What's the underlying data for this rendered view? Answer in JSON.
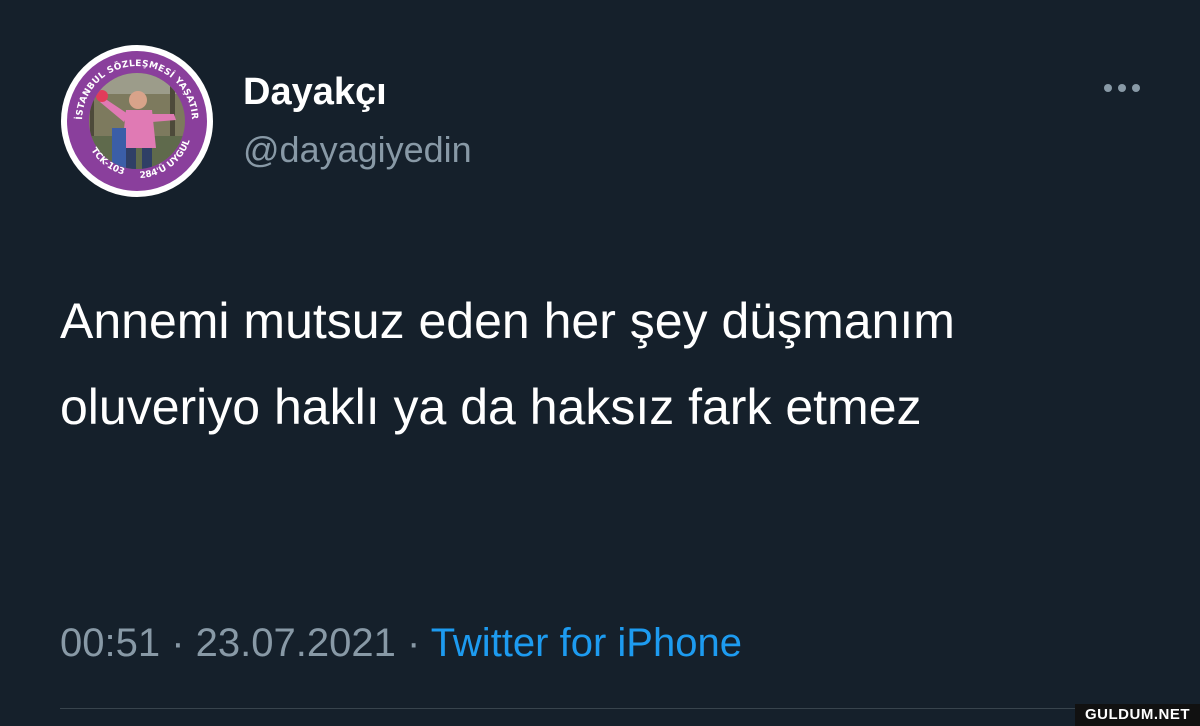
{
  "author": {
    "display_name": "Dayakçı",
    "handle": "@dayagiyedin"
  },
  "avatar": {
    "badge_top_text": "İSTANBUL SÖZLEŞMESİ YAŞATIR",
    "badge_left_text": "TCK-103",
    "badge_right_text": "6284'Ü UYGULA",
    "ring_color": "#8a3f9c"
  },
  "tweet": {
    "text": "Annemi mutsuz eden her şey düşmanım oluveriyo haklı ya da haksız fark etmez",
    "time": "00:51",
    "separator": " · ",
    "date": "23.07.2021",
    "source": "Twitter for iPhone"
  },
  "more_icon": "more-horizontal-icon",
  "watermark": "GULDUM.NET",
  "colors": {
    "background": "#15202b",
    "secondary_text": "#8899a6",
    "link": "#1d9bf0",
    "divider": "#38444d"
  }
}
